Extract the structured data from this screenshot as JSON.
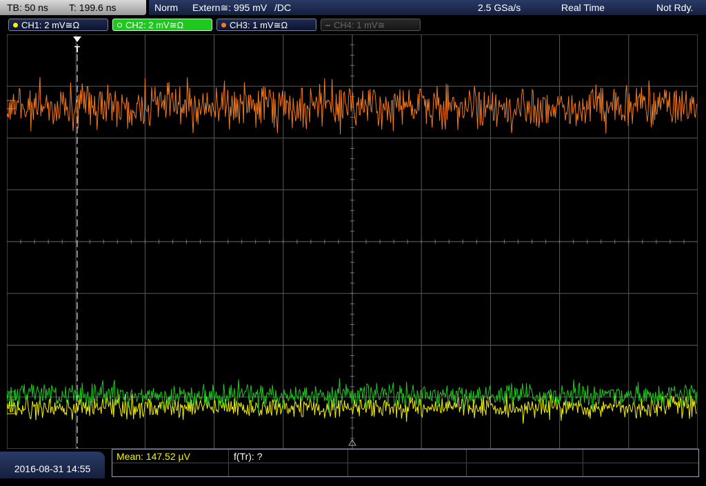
{
  "header": {
    "timebase": "TB: 50 ns",
    "trigger_time": "T: 199.6 ns",
    "mode": "Norm",
    "trigger_source": "Extern≅: 995 mV",
    "trigger_edge": "/DC",
    "sample_rate": "2.5 GSa/s",
    "acq_mode": "Real Time",
    "status": "Not Rdy."
  },
  "channels": [
    {
      "label": "CH1: 2 mV≅Ω",
      "color": "#f5f500",
      "state": "on"
    },
    {
      "label": "CH2: 2 mV≅Ω",
      "color": "#1ec81e",
      "state": "selected"
    },
    {
      "label": "CH3: 1 mV≅Ω",
      "color": "#f57a1a",
      "state": "on"
    },
    {
      "label": "CH4: 1 mV≅",
      "color": "#666666",
      "state": "off"
    }
  ],
  "trigger_marker": "T",
  "footer": {
    "datetime": "2016-08-31 14:55",
    "measurement_1": "Mean: 147.52 µV",
    "measurement_2": "f(Tr): ?"
  },
  "colors": {
    "ch1": "#f5f500",
    "ch2": "#1ec81e",
    "ch3": "#f57a1a",
    "grid": "#5a5a5a",
    "status_bar": "#1e2c55"
  }
}
